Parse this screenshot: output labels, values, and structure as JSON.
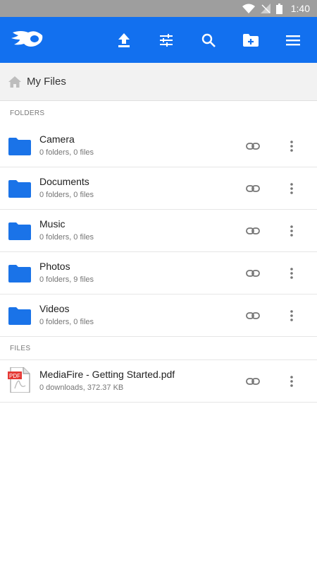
{
  "status_bar": {
    "time": "1:40"
  },
  "app_bar": {
    "logo": "mediafire-logo",
    "actions": [
      "upload-icon",
      "filter-icon",
      "search-icon",
      "new-folder-icon",
      "menu-icon"
    ]
  },
  "breadcrumb": {
    "label": "My Files"
  },
  "sections": {
    "folders_label": "FOLDERS",
    "files_label": "FILES"
  },
  "folders": [
    {
      "name": "Camera",
      "meta": "0 folders, 0 files"
    },
    {
      "name": "Documents",
      "meta": "0 folders, 0 files"
    },
    {
      "name": "Music",
      "meta": "0 folders, 0 files"
    },
    {
      "name": "Photos",
      "meta": "0 folders, 9 files"
    },
    {
      "name": "Videos",
      "meta": "0 folders, 0 files"
    }
  ],
  "files": [
    {
      "name": "MediaFire - Getting Started.pdf",
      "meta": "0 downloads, 372.37 KB",
      "type_badge": "PDF"
    }
  ],
  "colors": {
    "accent": "#1270ef",
    "folder": "#1a73e8",
    "status_bar": "#9e9e9e"
  }
}
